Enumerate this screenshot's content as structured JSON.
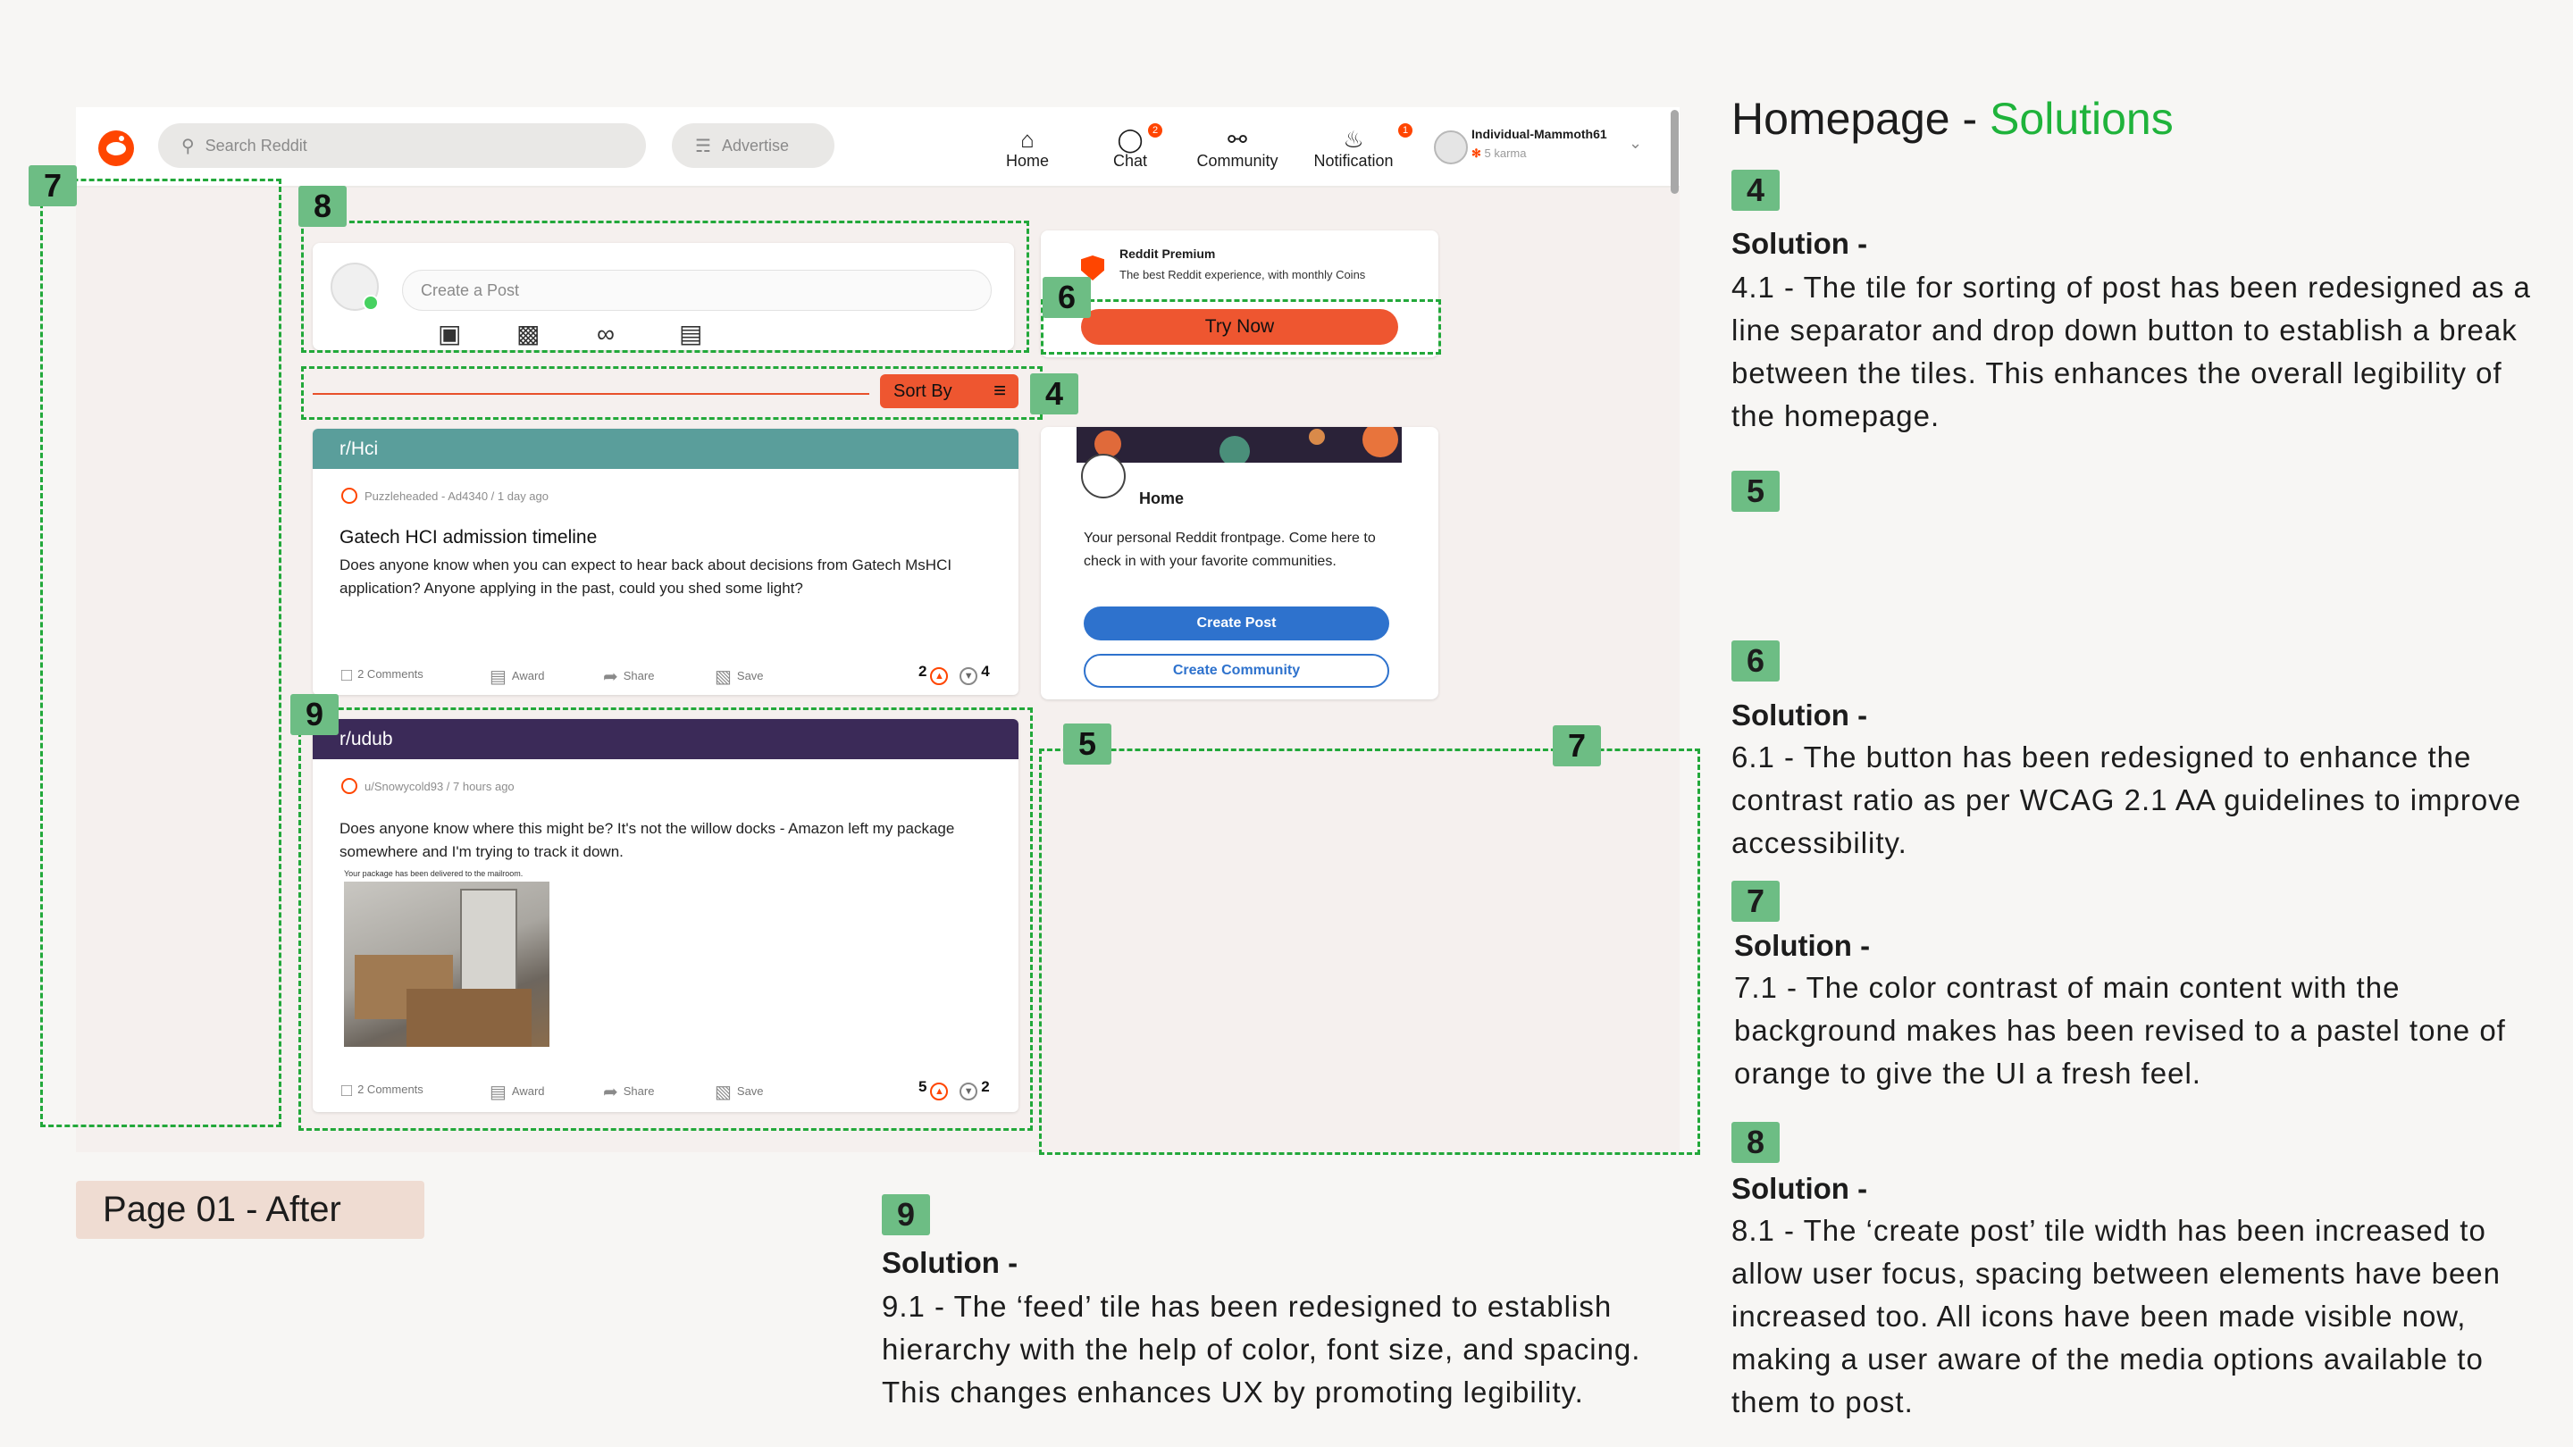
{
  "topbar": {
    "search_placeholder": "Search Reddit",
    "advertise_label": "Advertise",
    "nav": [
      {
        "label": "Home",
        "icon": "home-icon"
      },
      {
        "label": "Chat",
        "icon": "chat-icon",
        "badge": "2"
      },
      {
        "label": "Community",
        "icon": "community-icon"
      },
      {
        "label": "Notification",
        "icon": "bell-icon",
        "badge": "1"
      }
    ],
    "user": {
      "name": "Individual-Mammoth61",
      "karma": "5 karma"
    }
  },
  "create_post": {
    "placeholder": "Create a Post"
  },
  "premium": {
    "title": "Reddit Premium",
    "description": "The best Reddit experience, with monthly Coins",
    "button": "Try Now"
  },
  "sort": {
    "label": "Sort By"
  },
  "posts": [
    {
      "subreddit": "r/Hci",
      "header_color": "#5a9e9b",
      "meta": "Puzzleheaded - Ad4340 / 1 day ago",
      "title": "Gatech HCI admission timeline",
      "body": "Does anyone know when you can expect to hear back about decisions from Gatech MsHCI application? Anyone applying in the past, could you shed some light?",
      "comments": "2 Comments",
      "award": "Award",
      "share": "Share",
      "save": "Save",
      "upvotes": "2",
      "downvotes": "4"
    },
    {
      "subreddit": "r/udub",
      "header_color": "#3b2a58",
      "meta": "u/Snowycold93 / 7 hours ago",
      "title": "",
      "body": "Does anyone know where this might be? It's not the willow docks - Amazon left my package somewhere and I'm trying to track it down.",
      "image_caption": "Your package has been delivered to the mailroom.",
      "comments": "2 Comments",
      "award": "Award",
      "share": "Share",
      "save": "Save",
      "upvotes": "5",
      "downvotes": "2"
    }
  ],
  "home_card": {
    "title": "Home",
    "description": "Your personal Reddit frontpage. Come here to check in with your favorite communities.",
    "create_post": "Create Post",
    "create_community": "Create Community"
  },
  "annotations": {
    "tag_7": "7",
    "tag_8": "8",
    "tag_6": "6",
    "tag_4": "4",
    "tag_9": "9",
    "tag_5": "5",
    "tag_7b": "7"
  },
  "page_label": "Page 01 - After",
  "panel": {
    "heading_prefix": "Homepage - ",
    "heading_accent": "Solutions",
    "solutions": [
      {
        "num": "4",
        "head": "Solution -",
        "text": "4.1 - The tile for sorting of post has been redesigned as a line separator and drop down button to establish a break between the tiles. This enhances the overall legibility of the homepage."
      },
      {
        "num": "5",
        "head": "",
        "text": ""
      },
      {
        "num": "6",
        "head": "Solution -",
        "text": "6.1 - The button has been redesigned to enhance the contrast ratio as per WCAG 2.1 AA guidelines to improve accessibility."
      },
      {
        "num": "7",
        "head": "Solution -",
        "text": "7.1 - The color contrast of main content with the background makes has been revised to a pastel tone of orange to give the UI a fresh feel."
      },
      {
        "num": "8",
        "head": "Solution -",
        "text": "8.1 - The ‘create post’ tile width has been increased to allow user focus, spacing between elements have been increased too. All icons have been made visible now, making a user aware of the media options available to them to post."
      },
      {
        "num": "9",
        "head": "Solution -",
        "text": "9.1 - The ‘feed’ tile has been redesigned to establish hierarchy with the help of color, font size, and spacing. This changes enhances UX by promoting legibility."
      }
    ]
  },
  "colors": {
    "accent": "#ff4500",
    "annotation_green": "#22a83a",
    "tag_green": "#6dbd84",
    "primary_blue": "#2e72cd"
  }
}
